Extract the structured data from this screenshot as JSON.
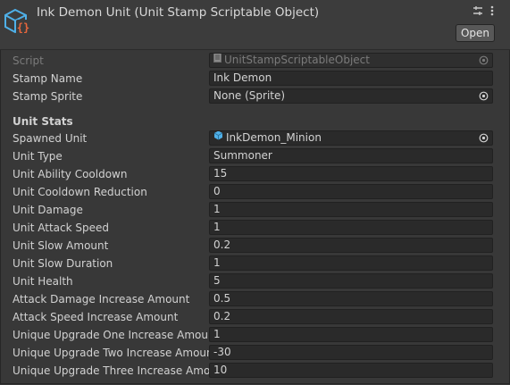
{
  "header": {
    "title": "Ink Demon Unit (Unit Stamp Scriptable Object)",
    "open_label": "Open"
  },
  "script_row": {
    "label": "Script",
    "value": "UnitStampScriptableObject"
  },
  "top_fields": [
    {
      "label": "Stamp Name",
      "value": "Ink Demon"
    },
    {
      "label": "Stamp Sprite",
      "value": "None (Sprite)"
    }
  ],
  "section": {
    "title": "Unit Stats"
  },
  "spawned_unit": {
    "label": "Spawned Unit",
    "value": "InkDemon_Minion"
  },
  "stats": [
    {
      "label": "Unit Type",
      "value": "Summoner"
    },
    {
      "label": "Unit Ability Cooldown",
      "value": "15"
    },
    {
      "label": "Unit Cooldown Reduction",
      "value": "0"
    },
    {
      "label": "Unit Damage",
      "value": "1"
    },
    {
      "label": "Unit Attack Speed",
      "value": "1"
    },
    {
      "label": "Unit Slow Amount",
      "value": "0.2"
    },
    {
      "label": "Unit Slow Duration",
      "value": "1"
    },
    {
      "label": "Unit Health",
      "value": "5"
    },
    {
      "label": "Attack Damage Increase Amount",
      "value": "0.5"
    },
    {
      "label": "Attack Speed Increase Amount",
      "value": "0.2"
    },
    {
      "label": "Unique Upgrade One Increase Amount",
      "value": "1"
    },
    {
      "label": "Unique Upgrade Two Increase Amount",
      "value": "-30"
    },
    {
      "label": "Unique Upgrade Three Increase Amoun",
      "value": "10"
    }
  ],
  "icons": {
    "header": "scriptable-object-icon",
    "script": "script-file-icon",
    "prefab": "prefab-cube-icon",
    "picker": "object-picker-icon"
  },
  "colors": {
    "background": "#383838",
    "field_bg": "#2a2a2a",
    "text": "#d2d2d2",
    "disabled_text": "#7b7b7b",
    "icon_blue": "#4fb0e8",
    "icon_orange": "#e8663c"
  }
}
